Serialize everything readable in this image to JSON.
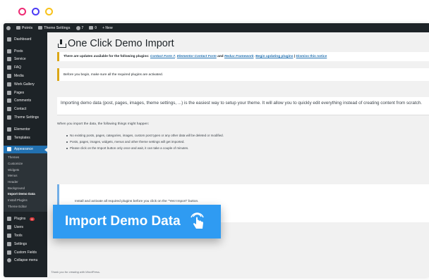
{
  "window_dots": {
    "colors": [
      "#ee2a73",
      "#4b3bf5",
      "#f8c21a"
    ]
  },
  "admin_bar": {
    "site_name": "Points",
    "theme_settings": "Theme Settings",
    "updates_count": "7",
    "comments_count": "0",
    "new_label": "+ New"
  },
  "sidebar": {
    "items_top": [
      {
        "label": "Dashboard",
        "icon": "dashboard-icon"
      },
      {
        "label": "Posts",
        "icon": "pin-icon"
      },
      {
        "label": "Service",
        "icon": "service-icon"
      },
      {
        "label": "FAQ",
        "icon": "faq-icon"
      },
      {
        "label": "Media",
        "icon": "media-icon"
      },
      {
        "label": "Work Gallery",
        "icon": "gallery-icon"
      },
      {
        "label": "Pages",
        "icon": "pages-icon"
      },
      {
        "label": "Comments",
        "icon": "comments-icon"
      },
      {
        "label": "Contact",
        "icon": "contact-icon"
      },
      {
        "label": "Theme Settings",
        "icon": "settings-icon"
      },
      {
        "label": "Elementor",
        "icon": "elementor-icon"
      },
      {
        "label": "Templates",
        "icon": "templates-icon"
      }
    ],
    "appearance": {
      "label": "Appearance",
      "icon": "appearance-icon"
    },
    "submenu": [
      "Themes",
      "Customize",
      "Widgets",
      "Menus",
      "Header",
      "Background",
      "Import Demo Data",
      "Install Plugins",
      "Theme Editor"
    ],
    "submenu_current": "Import Demo Data",
    "items_bottom": [
      {
        "label": "Plugins",
        "icon": "plugins-icon",
        "badge": "6"
      },
      {
        "label": "Users",
        "icon": "users-icon"
      },
      {
        "label": "Tools",
        "icon": "tools-icon"
      },
      {
        "label": "Settings",
        "icon": "settings-icon"
      },
      {
        "label": "Custom Fields",
        "icon": "custom-fields-icon"
      },
      {
        "label": "Collapse menu",
        "icon": "collapse-icon"
      }
    ]
  },
  "main": {
    "title": "One Click Demo Import",
    "update_notice": {
      "prefix": "There are updates available for the following plugins:",
      "plugin1": "Contact Form 7",
      "plugin2": "Elementor Contact Form",
      "and": "and",
      "plugin3": "Redux Framework",
      "begin": "Begin updating plugins",
      "divider": "|",
      "dismiss": "Dismiss this notice"
    },
    "required_notice": "Before you begin, make sure all the required plugins are activated.",
    "intro": "Importing demo data (post, pages, images, theme settings, ...) is the easiest way to setup your theme. It will allow you to quickly edit everything instead of creating content from scratch.",
    "happen": "When you import the data, the following things might happen:",
    "bullets": [
      "No existing posts, pages, categories, images, custom post types or any other data will be deleted or modified.",
      "Posts, pages, images, widgets, menus and other theme settings will get imported.",
      "Please click on the Import button only once and wait, it can take a couple of minutes."
    ],
    "install_notice": "Install and activate all required plugins before you click on the \"Yes! Import\" button.",
    "import_button": "Import Demo Data",
    "footer": "Thank you for creating with WordPress."
  },
  "colors": {
    "accent": "#2f9bf2",
    "sidebar_bg": "#1d2327",
    "active": "#2271b1"
  }
}
